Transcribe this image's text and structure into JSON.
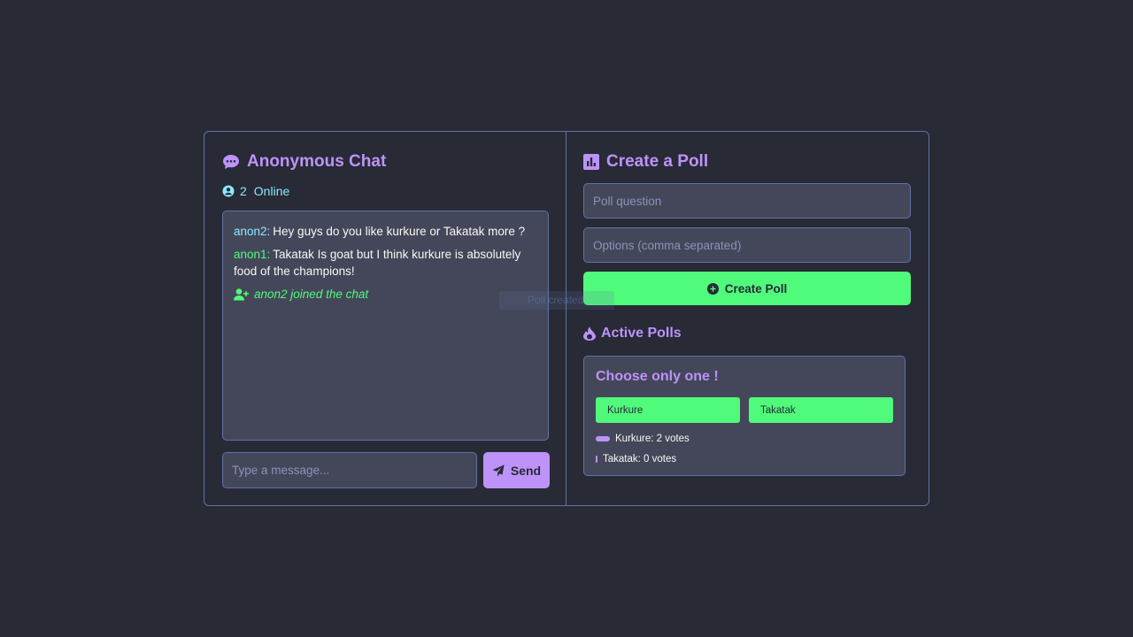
{
  "chat": {
    "title": "Anonymous Chat",
    "online_count": "2",
    "online_label": "Online",
    "messages": [
      {
        "user": "anon2:",
        "text": "Hey guys do you like kurkure or Takatak more ?"
      },
      {
        "user": "anon1:",
        "text": "Takatak Is goat but I think kurkure is absolutely food of the champions!"
      }
    ],
    "system_message": "anon2 joined the chat",
    "input_placeholder": "Type a message...",
    "send_label": "Send",
    "ghost_text": "Poll created"
  },
  "poll_form": {
    "title": "Create a Poll",
    "question_placeholder": "Poll question",
    "options_placeholder": "Options (comma separated)",
    "create_label": "Create Poll"
  },
  "active_polls": {
    "title": "Active Polls",
    "polls": [
      {
        "question": "Choose only one !",
        "options": [
          "Kurkure",
          "Takatak"
        ],
        "results": [
          {
            "label": "Kurkure: 2 votes",
            "votes": 2,
            "share": 1.0
          },
          {
            "label": "Takatak: 0 votes",
            "votes": 0,
            "share": 0.0
          }
        ]
      }
    ]
  },
  "colors": {
    "background": "#282a36",
    "panel": "#44475a",
    "border": "#6272a4",
    "accent": "#bd93f9",
    "green": "#50fa7b",
    "cyan": "#8be9fd"
  },
  "icons": {
    "chat_title": "speech-bubble-icon",
    "online": "user-circle-icon",
    "system": "user-plus-icon",
    "send": "paper-plane-icon",
    "poll_title": "bar-chart-icon",
    "create": "plus-circle-icon",
    "active": "fire-icon"
  }
}
